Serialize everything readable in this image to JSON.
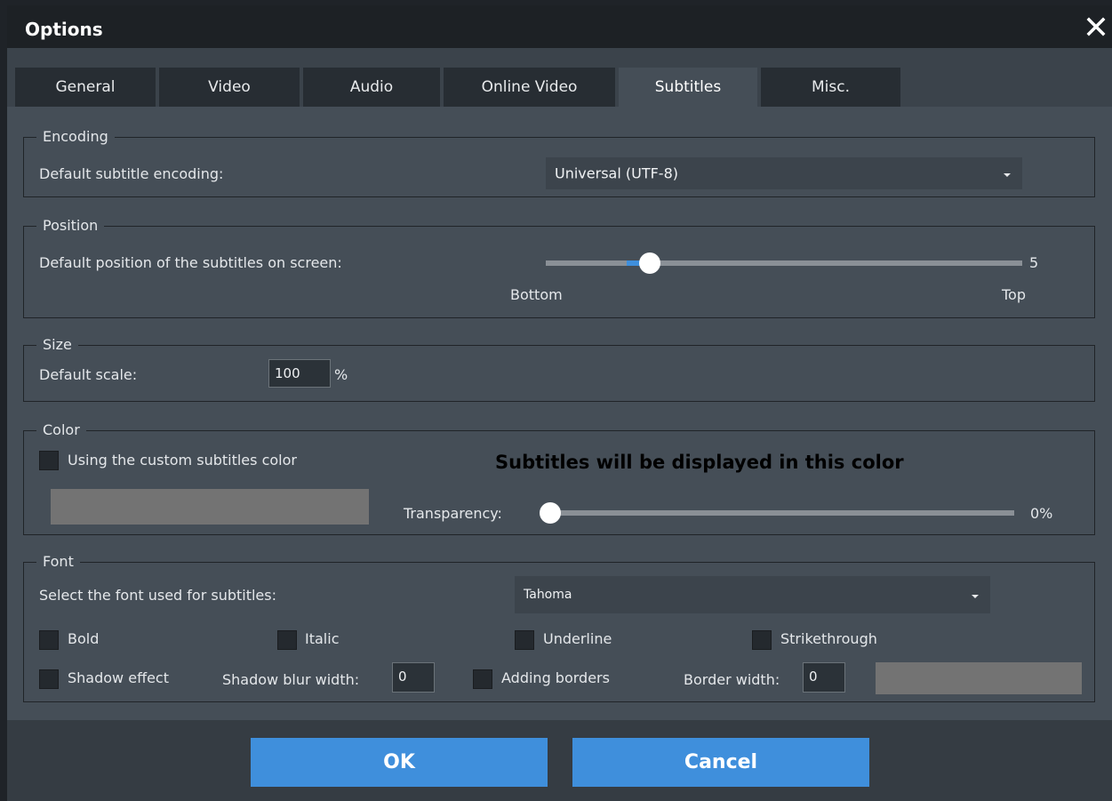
{
  "dialog": {
    "title": "Options",
    "close_icon": "close-icon"
  },
  "tabs": [
    {
      "label": "General"
    },
    {
      "label": "Video"
    },
    {
      "label": "Audio"
    },
    {
      "label": "Online Video"
    },
    {
      "label": "Subtitles",
      "active": true
    },
    {
      "label": "Misc."
    }
  ],
  "encoding": {
    "legend": "Encoding",
    "label": "Default subtitle encoding:",
    "value": "Universal (UTF-8)"
  },
  "position": {
    "legend": "Position",
    "label": "Default position of the subtitles on screen:",
    "value": "5",
    "min_label": "Bottom",
    "max_label": "Top",
    "slider_fraction": 0.22
  },
  "size": {
    "legend": "Size",
    "label": "Default scale:",
    "value": "100",
    "unit": "%"
  },
  "color": {
    "legend": "Color",
    "checkbox_label": "Using the custom subtitles color",
    "preview_text": "Subtitles will be displayed in this color",
    "transparency_label": "Transparency:",
    "transparency_value": "0%",
    "swatch_color": "#737373"
  },
  "font": {
    "legend": "Font",
    "select_label": "Select the font used for subtitles:",
    "select_value": "Tahoma",
    "bold": "Bold",
    "italic": "Italic",
    "underline": "Underline",
    "strikethrough": "Strikethrough",
    "shadow_effect": "Shadow effect",
    "shadow_blur_label": "Shadow blur width:",
    "shadow_blur_value": "0",
    "adding_borders": "Adding borders",
    "border_width_label": "Border width:",
    "border_width_value": "0",
    "border_color": "#737373"
  },
  "buttons": {
    "ok": "OK",
    "cancel": "Cancel"
  },
  "colors": {
    "accent": "#3f8fdc",
    "background": "#454e57",
    "title_bar": "#1d2125"
  }
}
